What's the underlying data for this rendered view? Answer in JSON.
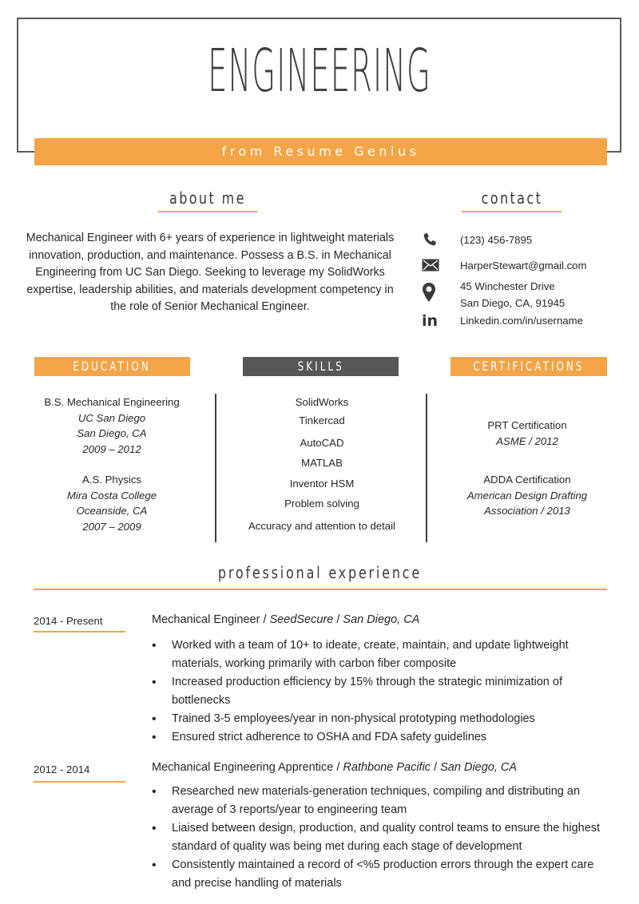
{
  "header": {
    "title": "ENGINEERING",
    "subtitle": "from Resume Genius",
    "accent_color": "#f3a547",
    "dark_color": "#575757"
  },
  "about": {
    "heading": "about me",
    "text": "Mechanical Engineer with 6+ years of experience in lightweight materials innovation, production, and maintenance. Possess a B.S. in Mechanical Engineering from UC San Diego. Seeking to leverage my SolidWorks expertise, leadership abilities, and materials development competency in the role of Senior Mechanical Engineer."
  },
  "contact": {
    "heading": "contact",
    "items": [
      {
        "icon": "phone-icon",
        "lines": [
          "(123) 456-7895"
        ]
      },
      {
        "icon": "envelope-icon",
        "lines": [
          "HarperStewart@gmail.com"
        ]
      },
      {
        "icon": "location-pin-icon",
        "lines": [
          "45 Winchester Drive",
          "San Diego, CA, 91945"
        ]
      },
      {
        "icon": "linkedin-icon",
        "lines": [
          "Linkedin.com/in/username"
        ]
      }
    ]
  },
  "education": {
    "heading": "EDUCATION",
    "entries": [
      {
        "degree": "B.S. Mechanical Engineering",
        "school": "UC San Diego",
        "location": "San Diego, CA",
        "years": "2009 – 2012"
      },
      {
        "degree": "A.S. Physics",
        "school": "Mira Costa College",
        "location": "Oceanside, CA",
        "years": "2007 – 2009"
      }
    ]
  },
  "skills": {
    "heading": "SKILLS",
    "items": [
      "SolidWorks",
      "Tinkercad",
      "AutoCAD",
      "MATLAB",
      "Inventor HSM",
      "Problem solving",
      "Accuracy and attention to detail"
    ]
  },
  "certifications": {
    "heading": "CERTIFICATIONS",
    "entries": [
      {
        "name": "PRT Certification",
        "detail_lines": [
          "ASME / 2012"
        ]
      },
      {
        "name": "ADDA Certification",
        "detail_lines": [
          "American Design Drafting",
          "Association / 2013"
        ]
      }
    ]
  },
  "experience": {
    "heading": "professional experience",
    "jobs": [
      {
        "dates": "2014 - Present",
        "role": "Mechanical Engineer",
        "company": "SeedSecure",
        "location": "San Diego, CA",
        "bullets": [
          "Worked with a team of 10+ to ideate, create, maintain, and update lightweight materials, working primarily with carbon fiber composite",
          "Increased production efficiency by 15% through the strategic minimization of bottlenecks",
          "Trained 3-5 employees/year in non-physical prototyping methodologies",
          "Ensured strict adherence to OSHA and FDA safety guidelines"
        ]
      },
      {
        "dates": "2012 - 2014",
        "role": "Mechanical Engineering Apprentice",
        "company": "Rathbone Pacific",
        "location": "San Diego, CA",
        "bullets": [
          "Researched new materials-generation techniques, compiling and distributing an average of 3 reports/year to engineering team",
          "Liaised between design, production, and quality control teams to ensure the highest standard of quality was being met during each stage of development",
          "Consistently maintained a record of <%5 production errors through the expert care and precise handling of materials"
        ]
      }
    ]
  }
}
